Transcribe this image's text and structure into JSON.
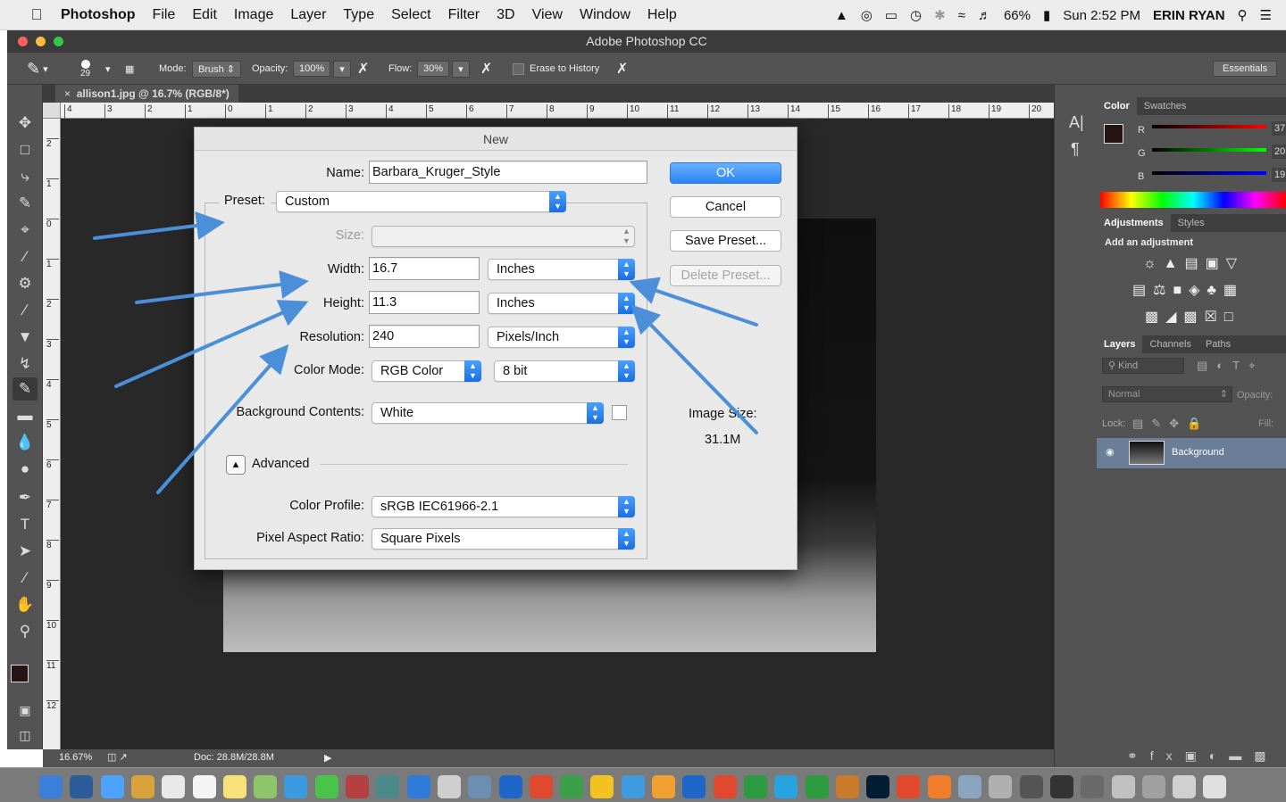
{
  "menubar": {
    "app_name": "Photoshop",
    "items": [
      "File",
      "Edit",
      "Image",
      "Layer",
      "Type",
      "Select",
      "Filter",
      "3D",
      "View",
      "Window",
      "Help"
    ],
    "battery": "66%",
    "clock": "Sun 2:52 PM",
    "user": "ERIN RYAN"
  },
  "window": {
    "title": "Adobe Photoshop CC"
  },
  "options_bar": {
    "brush_size": "29",
    "mode_label": "Mode:",
    "mode_value": "Brush",
    "opacity_label": "Opacity:",
    "opacity_value": "100%",
    "flow_label": "Flow:",
    "flow_value": "30%",
    "erase_history_label": "Erase to History",
    "workspace": "Essentials"
  },
  "document": {
    "tab_title": "allison1.jpg @ 16.7% (RGB/8*)",
    "zoom": "16.67%",
    "doc_size": "Doc: 28.8M/28.8M"
  },
  "ruler": {
    "h_labels": [
      "4",
      "3",
      "2",
      "1",
      "0",
      "1",
      "2",
      "3",
      "4",
      "5",
      "6",
      "7",
      "8",
      "9",
      "10",
      "11",
      "12",
      "13",
      "14",
      "15",
      "16",
      "17",
      "18",
      "19",
      "20"
    ],
    "v_labels": [
      "2",
      "1",
      "0",
      "1",
      "2",
      "3",
      "4",
      "5",
      "6",
      "7",
      "8",
      "9",
      "10",
      "11",
      "12"
    ]
  },
  "panels": {
    "color_tabs": [
      "Color",
      "Swatches"
    ],
    "rgb_labels": [
      "R",
      "G",
      "B"
    ],
    "rgb_values": [
      "37",
      "20",
      "19"
    ],
    "adjust_tabs": [
      "Adjustments",
      "Styles"
    ],
    "adjust_hint": "Add an adjustment",
    "layers_tabs": [
      "Layers",
      "Channels",
      "Paths"
    ],
    "kind_label": "Kind",
    "blend_mode": "Normal",
    "opacity_label": "Opacity:",
    "lock_label": "Lock:",
    "fill_label": "Fill:",
    "layer_name": "Background"
  },
  "dialog": {
    "title": "New",
    "name_label": "Name:",
    "name_value": "Barbara_Kruger_Style",
    "preset_label": "Preset:",
    "preset_value": "Custom",
    "size_label": "Size:",
    "width_label": "Width:",
    "width_value": "16.7",
    "width_unit": "Inches",
    "height_label": "Height:",
    "height_value": "11.3",
    "height_unit": "Inches",
    "resolution_label": "Resolution:",
    "resolution_value": "240",
    "resolution_unit": "Pixels/Inch",
    "color_mode_label": "Color Mode:",
    "color_mode_value": "RGB Color",
    "bit_depth": "8 bit",
    "background_label": "Background Contents:",
    "background_value": "White",
    "advanced_label": "Advanced",
    "color_profile_label": "Color Profile:",
    "color_profile_value": "sRGB IEC61966-2.1",
    "pixel_aspect_label": "Pixel Aspect Ratio:",
    "pixel_aspect_value": "Square Pixels",
    "ok": "OK",
    "cancel": "Cancel",
    "save_preset": "Save Preset...",
    "delete_preset": "Delete Preset...",
    "image_size_label": "Image Size:",
    "image_size_value": "31.1M"
  },
  "colors": {
    "accent": "#4a8fd8",
    "ok_button": "#2a84f4",
    "foreground_swatch": "#251413"
  }
}
